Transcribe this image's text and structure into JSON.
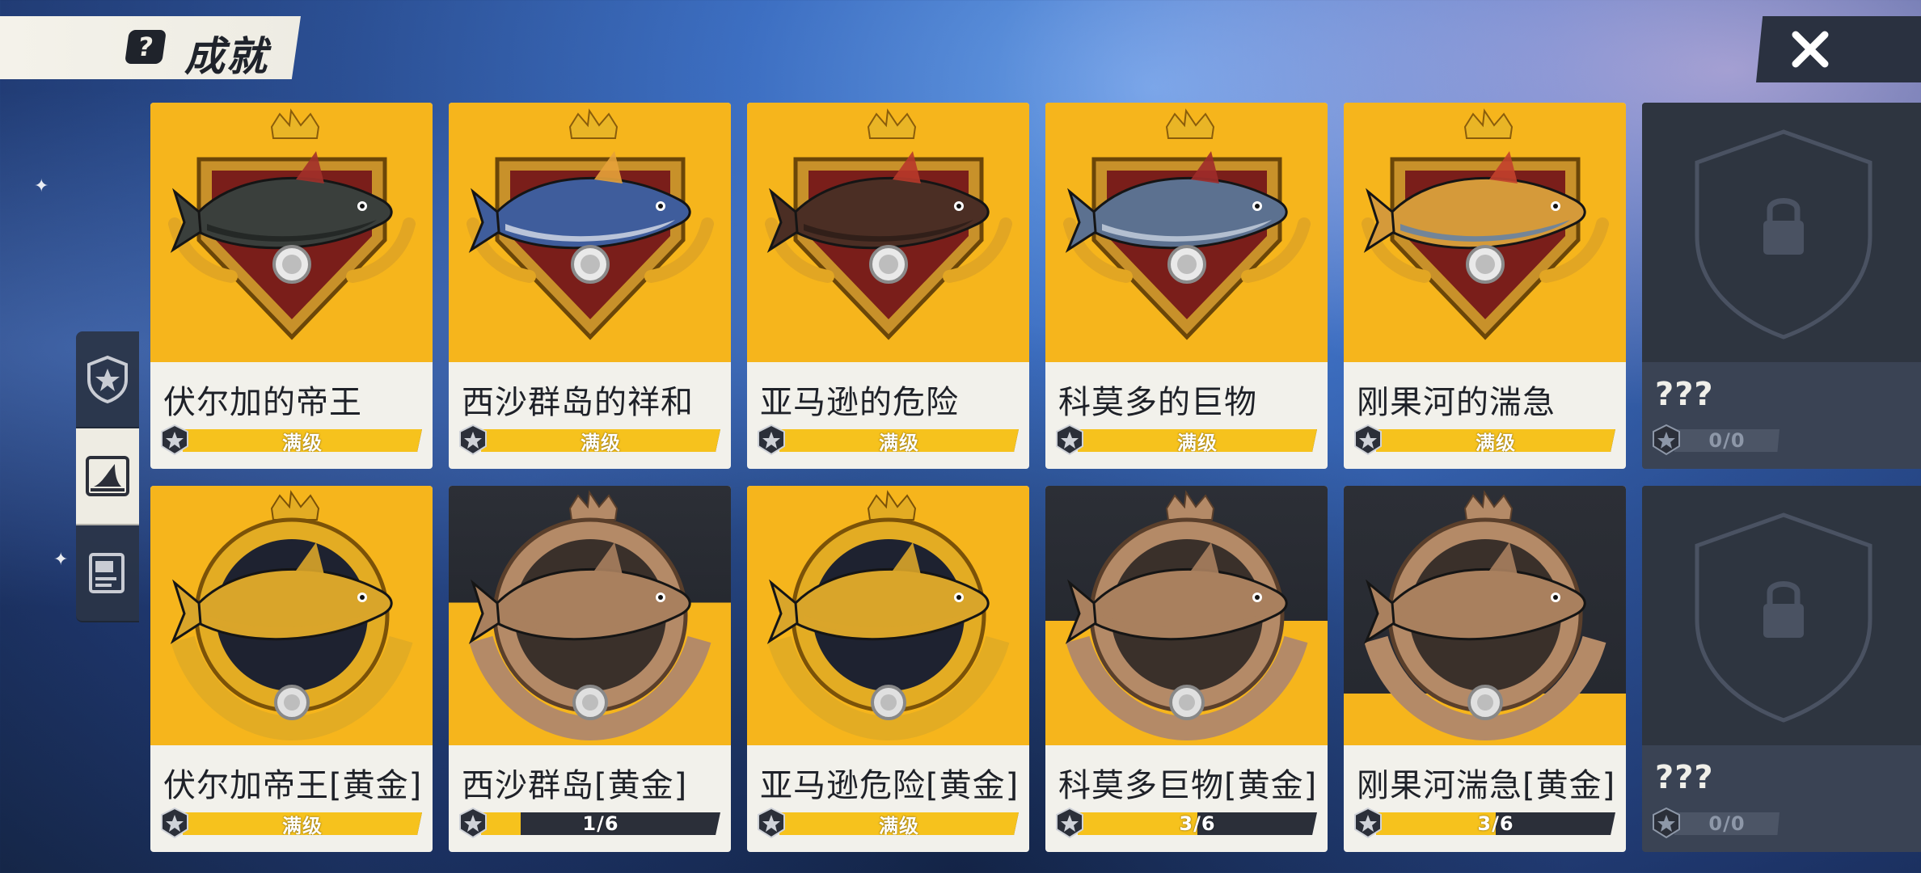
{
  "header": {
    "title": "成就",
    "help_icon": "question-icon",
    "close_icon": "close-icon"
  },
  "side_tabs": [
    {
      "icon": "star-shield-icon",
      "active": false
    },
    {
      "icon": "shark-fin-icon",
      "active": true
    },
    {
      "icon": "book-icon",
      "active": false
    }
  ],
  "colors": {
    "card_gold": "#f6b51c",
    "card_dark": "#2c2f36",
    "card_locked": "#3a4354",
    "progress_fill": "#f6c21d",
    "text_dark": "#1e2128"
  },
  "achievements": [
    {
      "name": "伏尔加的帝王",
      "progress_label": "满级",
      "progress": 1.0,
      "locked": false,
      "medal": "shield",
      "fish": "sturgeon"
    },
    {
      "name": "西沙群岛的祥和",
      "progress_label": "满级",
      "progress": 1.0,
      "locked": false,
      "medal": "shield",
      "fish": "tuna"
    },
    {
      "name": "亚马逊的危险",
      "progress_label": "满级",
      "progress": 1.0,
      "locked": false,
      "medal": "shield",
      "fish": "arapaima"
    },
    {
      "name": "科莫多的巨物",
      "progress_label": "满级",
      "progress": 1.0,
      "locked": false,
      "medal": "shield",
      "fish": "shark"
    },
    {
      "name": "刚果河的湍急",
      "progress_label": "满级",
      "progress": 1.0,
      "locked": false,
      "medal": "shield",
      "fish": "tigerfish"
    },
    {
      "name": "???",
      "progress_label": "0/0",
      "progress": 0,
      "locked": true,
      "medal": "lock",
      "fish": ""
    },
    {
      "name": "伏尔加帝王[黄金]",
      "progress_label": "满级",
      "progress": 1.0,
      "locked": false,
      "medal": "wreath-gold",
      "fish": "sturgeon"
    },
    {
      "name": "西沙群岛[黄金]",
      "progress_label": "1/6",
      "progress": 0.1667,
      "locked": false,
      "medal": "wreath-bronze",
      "fish": "tuna"
    },
    {
      "name": "亚马逊危险[黄金]",
      "progress_label": "满级",
      "progress": 1.0,
      "locked": false,
      "medal": "wreath-gold",
      "fish": "arapaima"
    },
    {
      "name": "科莫多巨物[黄金]",
      "progress_label": "3/6",
      "progress": 0.5,
      "locked": false,
      "medal": "wreath-bronze",
      "fish": "shark"
    },
    {
      "name": "刚果河湍急[黄金]",
      "progress_label": "3/6",
      "progress": 0.5,
      "locked": false,
      "medal": "wreath-bronze",
      "fish": "tigerfish"
    },
    {
      "name": "???",
      "progress_label": "0/0",
      "progress": 0,
      "locked": true,
      "medal": "lock",
      "fish": ""
    }
  ]
}
